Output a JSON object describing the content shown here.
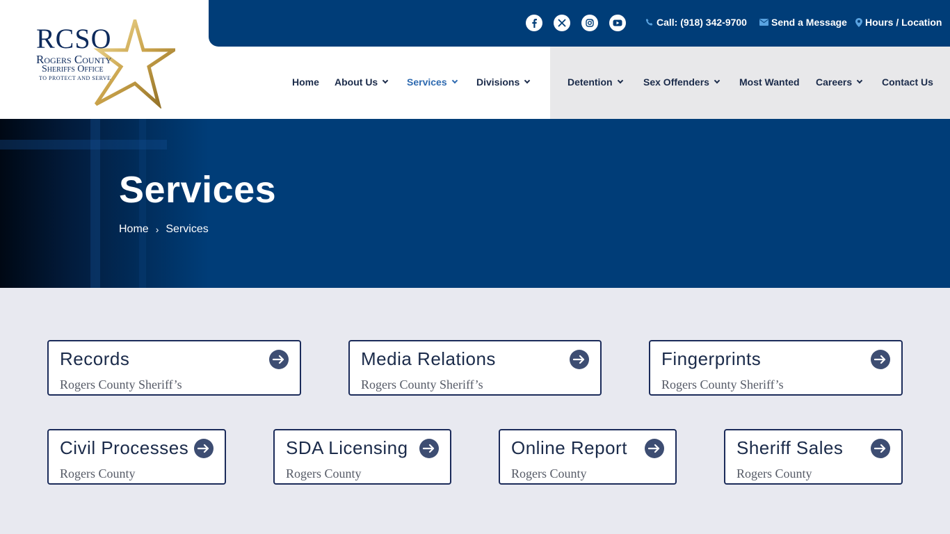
{
  "logo": {
    "title": "RCSO",
    "line1": "Rogers County",
    "line2": "Sheriffs Office",
    "motto": "TO PROTECT AND SERVE"
  },
  "topbar": {
    "social": [
      "facebook-icon",
      "x-icon",
      "instagram-icon",
      "youtube-icon"
    ],
    "call": "Call: (918) 342-9700",
    "message": "Send a Message",
    "location": "Hours / Location"
  },
  "nav": {
    "home": "Home",
    "about": "About Us",
    "services": "Services",
    "divisions": "Divisions",
    "detention": "Detention",
    "sex_offenders": "Sex Offenders",
    "most_wanted": "Most Wanted",
    "careers": "Careers",
    "contact": "Contact Us"
  },
  "hero": {
    "title": "Services",
    "breadcrumb": {
      "home": "Home",
      "separator": "›",
      "current": "Services"
    }
  },
  "cards": [
    {
      "title": "Records",
      "subtitle": "Rogers County Sheriff’s"
    },
    {
      "title": "Media Relations",
      "subtitle": "Rogers County Sheriff’s"
    },
    {
      "title": "Fingerprints",
      "subtitle": "Rogers County Sheriff’s"
    },
    {
      "title": "Civil Processes",
      "subtitle": "Rogers County"
    },
    {
      "title": "SDA Licensing",
      "subtitle": "Rogers County"
    },
    {
      "title": "Online Report",
      "subtitle": "Rogers County"
    },
    {
      "title": "Sheriff Sales",
      "subtitle": "Rogers County"
    }
  ],
  "colors": {
    "brand_blue": "#003d78",
    "nav_active": "#2e6ab0",
    "card_border": "#1b2b5a",
    "gold": "#c9a24a"
  }
}
